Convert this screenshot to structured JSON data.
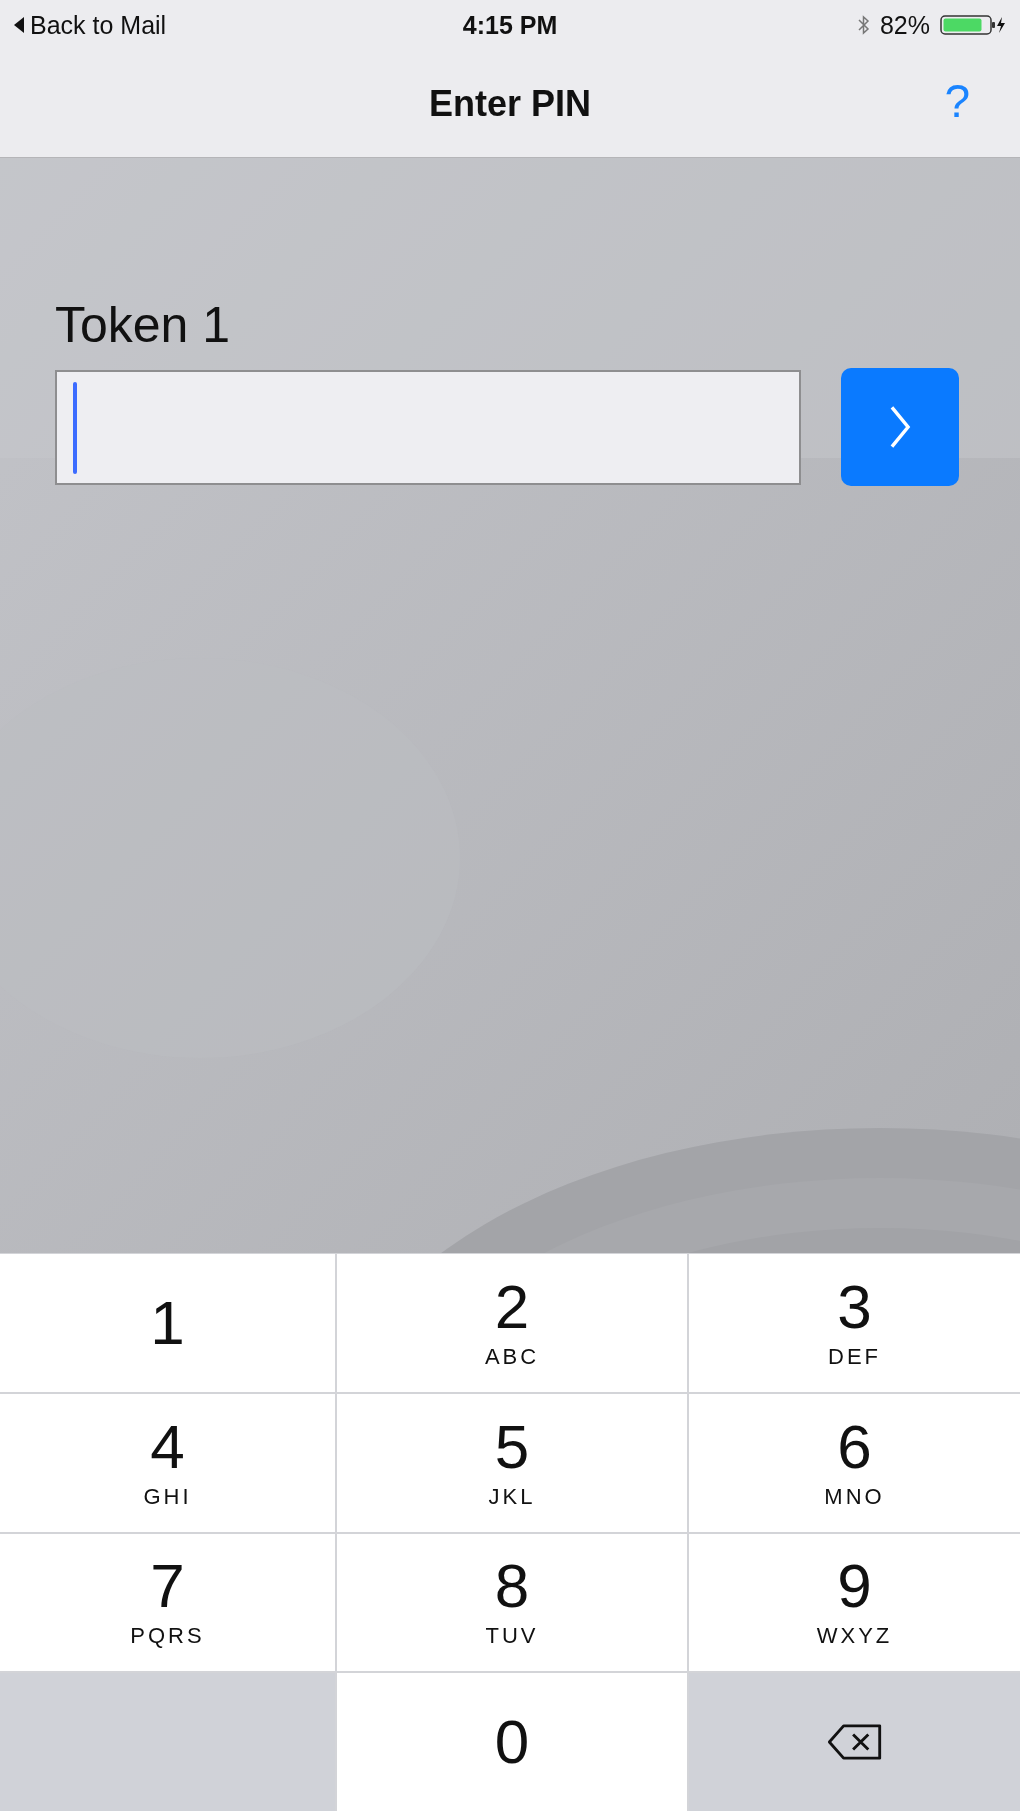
{
  "status_bar": {
    "back_label": "Back to Mail",
    "time": "4:15 PM",
    "battery": "82%"
  },
  "nav": {
    "title": "Enter PIN",
    "help": "?"
  },
  "token": {
    "label": "Token 1",
    "focused": true
  },
  "keypad": [
    {
      "kind": "digit",
      "digit": "1"
    },
    {
      "kind": "digit",
      "digit": "2",
      "letters": "ABC"
    },
    {
      "kind": "digit",
      "digit": "3",
      "letters": "DEF"
    },
    {
      "kind": "digit",
      "digit": "4",
      "letters": "GHI"
    },
    {
      "kind": "digit",
      "digit": "5",
      "letters": "JKL"
    },
    {
      "kind": "digit",
      "digit": "6",
      "letters": "MNO"
    },
    {
      "kind": "digit",
      "digit": "7",
      "letters": "PQRS"
    },
    {
      "kind": "digit",
      "digit": "8",
      "letters": "TUV"
    },
    {
      "kind": "digit",
      "digit": "9",
      "letters": "WXYZ"
    },
    {
      "kind": "blank"
    },
    {
      "kind": "digit",
      "digit": "0"
    },
    {
      "kind": "backspace"
    }
  ]
}
